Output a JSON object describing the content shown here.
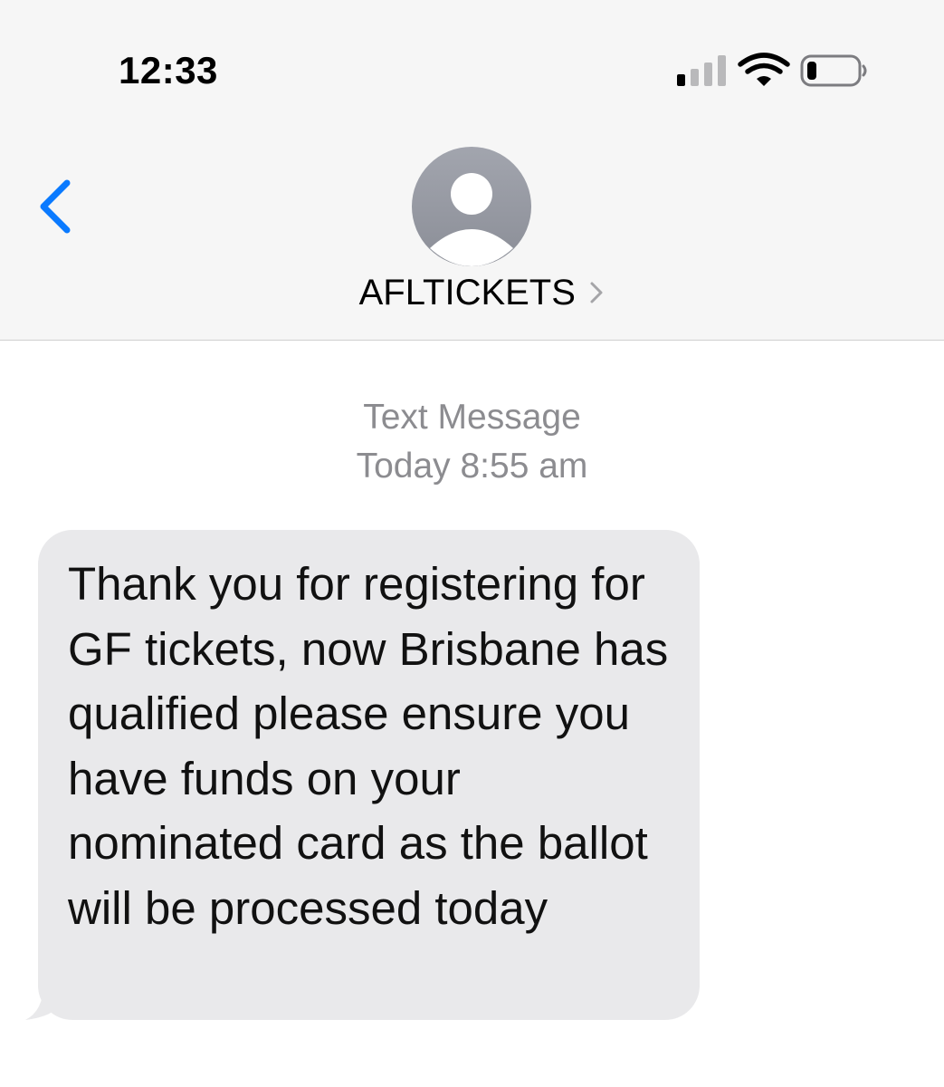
{
  "status_bar": {
    "time": "12:33",
    "icons": [
      "cellular-signal-icon",
      "wifi-icon",
      "battery-icon"
    ]
  },
  "header": {
    "back_icon": "chevron-left-icon",
    "avatar_icon": "person-placeholder-icon",
    "contact_name": "AFLTICKETS",
    "contact_chevron_icon": "chevron-right-icon"
  },
  "thread": {
    "message_kind": "Text Message",
    "timestamp": "Today 8:55 am"
  },
  "message": {
    "text": "Thank you for registering for GF tickets, now Brisbane has qualified please ensure you have funds on your nominated card as the ballot will be processed today"
  },
  "colors": {
    "accent": "#0a7aff",
    "bubble_incoming": "#e9e9eb",
    "header_background": "#f6f6f6",
    "meta_text": "#8c8c90",
    "avatar": "#989ba3"
  }
}
